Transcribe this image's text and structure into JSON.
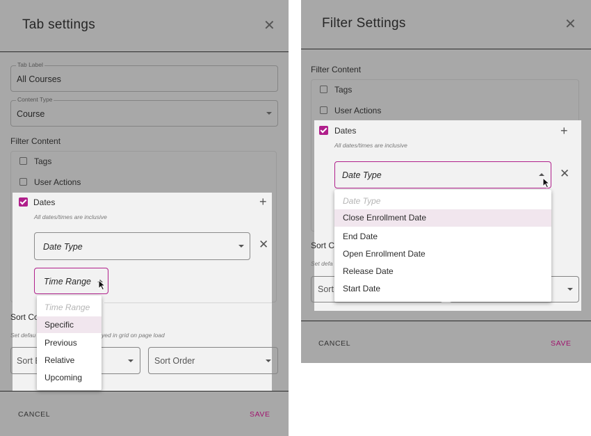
{
  "left": {
    "title": "Tab settings",
    "tab_label": {
      "label": "Tab Label",
      "value": "All Courses"
    },
    "content_type": {
      "label": "Content Type",
      "value": "Course"
    },
    "filter_content_label": "Filter Content",
    "checkboxes": [
      {
        "label": "Tags",
        "checked": false
      },
      {
        "label": "User Actions",
        "checked": false
      },
      {
        "label": "Dates",
        "checked": true
      }
    ],
    "dates_hint": "All dates/times are inclusive",
    "date_type_placeholder": "Date Type",
    "time_range_placeholder": "Time Range",
    "time_range_menu": {
      "header": "Time Range",
      "options": [
        "Specific",
        "Previous",
        "Relative",
        "Upcoming"
      ],
      "highlighted": "Specific"
    },
    "sort_label_partial": "Sort Co",
    "sort_hint_left": "Set defau",
    "sort_hint_right": "yed in grid on page load",
    "sort_by_partial": "Sort B",
    "sort_order": "Sort Order",
    "cancel": "CANCEL",
    "save": "SAVE"
  },
  "right": {
    "title": "Filter Settings",
    "filter_content_label": "Filter Content",
    "checkboxes": [
      {
        "label": "Tags",
        "checked": false
      },
      {
        "label": "User Actions",
        "checked": false
      },
      {
        "label": "Dates",
        "checked": true
      }
    ],
    "dates_hint": "All dates/times are inclusive",
    "date_type_placeholder": "Date Type",
    "date_type_menu": {
      "header": "Date Type",
      "options": [
        "Close Enrollment Date",
        "End Date",
        "Open Enrollment Date",
        "Release Date",
        "Start Date"
      ],
      "highlighted": "Close Enrollment Date"
    },
    "sort_label_partial": "Sort C",
    "sort_hint_partial": "Set defa",
    "sort_by_partial": "Sort",
    "cancel": "CANCEL",
    "save": "SAVE"
  },
  "colors": {
    "accent": "#b01f8b",
    "overlay": "#a8a8a8",
    "highlight": "#f1e6ee"
  }
}
